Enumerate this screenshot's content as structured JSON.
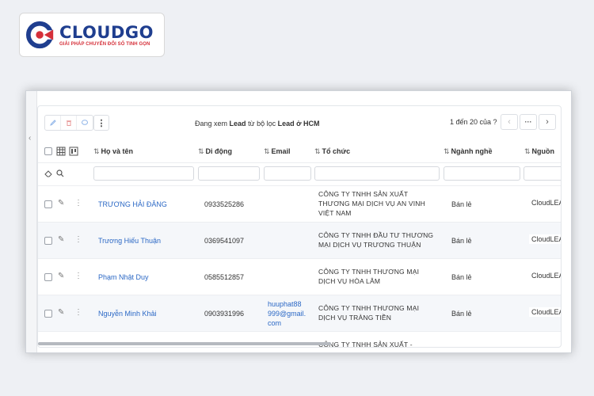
{
  "brand": {
    "name": "CLOUDGO",
    "tagline": "GIẢI PHÁP CHUYỂN ĐỔI SỐ TINH GỌN"
  },
  "toolbar": {
    "filter_prefix": "Đang xem",
    "filter_module": "Lead",
    "filter_mid": "từ bộ lọc",
    "filter_name": "Lead ở HCM",
    "pager": "1 đến 20 của ?"
  },
  "columns": {
    "name": "Họ và tên",
    "mobile": "Di động",
    "email": "Email",
    "org": "Tổ chức",
    "industry": "Ngành nghề",
    "source": "Nguồn"
  },
  "rows": [
    {
      "name": "TRƯƠNG HẢI ĐĂNG",
      "mobile": "0933525286",
      "email": "",
      "org": "CÔNG TY TNHH SẢN XUẤT THƯƠNG MẠI DỊCH VỤ AN VINH VIỆT NAM",
      "industry": "Bán lẻ",
      "source": "CloudLEA"
    },
    {
      "name": "Trương Hiếu Thuận",
      "mobile": "0369541097",
      "email": "",
      "org": "CÔNG TY TNHH ĐẦU TƯ THƯƠNG MẠI DỊCH VỤ TRƯƠNG THUẬN",
      "industry": "Bán lẻ",
      "source": "CloudLEA"
    },
    {
      "name": "Phạm Nhật Duy",
      "mobile": "0585512857",
      "email": "",
      "org": "CÔNG TY TNHH THƯƠNG MẠI DỊCH VỤ HÒA LÂM",
      "industry": "Bán lẻ",
      "source": "CloudLEA"
    },
    {
      "name": "Nguyễn Minh Khải",
      "mobile": "0903931996",
      "email": "huuphat88 999@gmail. com",
      "org": "CÔNG TY TNHH THƯƠNG MẠI DỊCH VỤ TRÀNG TIỀN",
      "industry": "Bán lẻ",
      "source": "CloudLEA"
    },
    {
      "name": "",
      "mobile": "",
      "email": "",
      "org": "CÔNG TY TNHH SẢN XUẤT -",
      "industry": "",
      "source": ""
    }
  ]
}
